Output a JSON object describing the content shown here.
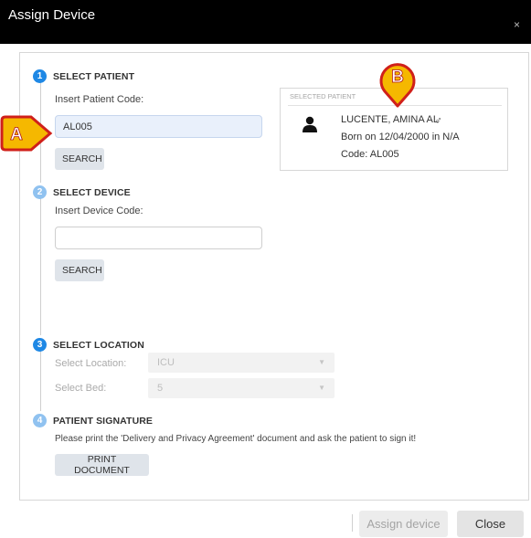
{
  "window": {
    "title": "Assign Device",
    "close_glyph": "×"
  },
  "steps": [
    {
      "number": "1",
      "title": "SELECT PATIENT",
      "label": "Insert Patient Code:",
      "input_value": "AL005",
      "button": "SEARCH"
    },
    {
      "number": "2",
      "title": "SELECT DEVICE",
      "label": "Insert Device Code:",
      "input_value": "",
      "button": "SEARCH"
    },
    {
      "number": "3",
      "title": "SELECT LOCATION",
      "location_label": "Select Location:",
      "location_value": "ICU",
      "bed_label": "Select Bed:",
      "bed_value": "5"
    },
    {
      "number": "4",
      "title": "PATIENT SIGNATURE",
      "instructions": "Please print the 'Delivery and Privacy Agreement' document and ask the patient to sign it!",
      "button": "PRINT DOCUMENT"
    }
  ],
  "selected_patient": {
    "header": "SELECTED PATIENT",
    "name": "LUCENTE, AMINA AL",
    "gender_glyph": "♂",
    "born": "Born on 12/04/2000 in N/A",
    "code": "Code: AL005"
  },
  "callouts": {
    "a": "A",
    "b": "B"
  },
  "footer": {
    "assign": "Assign device",
    "close": "Close"
  },
  "colors": {
    "accent": "#1e88e5",
    "callout_fill": "#f5b800",
    "callout_border": "#d0201a"
  },
  "icons": {
    "person": "person-icon",
    "male": "male-gender-icon",
    "caret": "caret-down-icon"
  }
}
